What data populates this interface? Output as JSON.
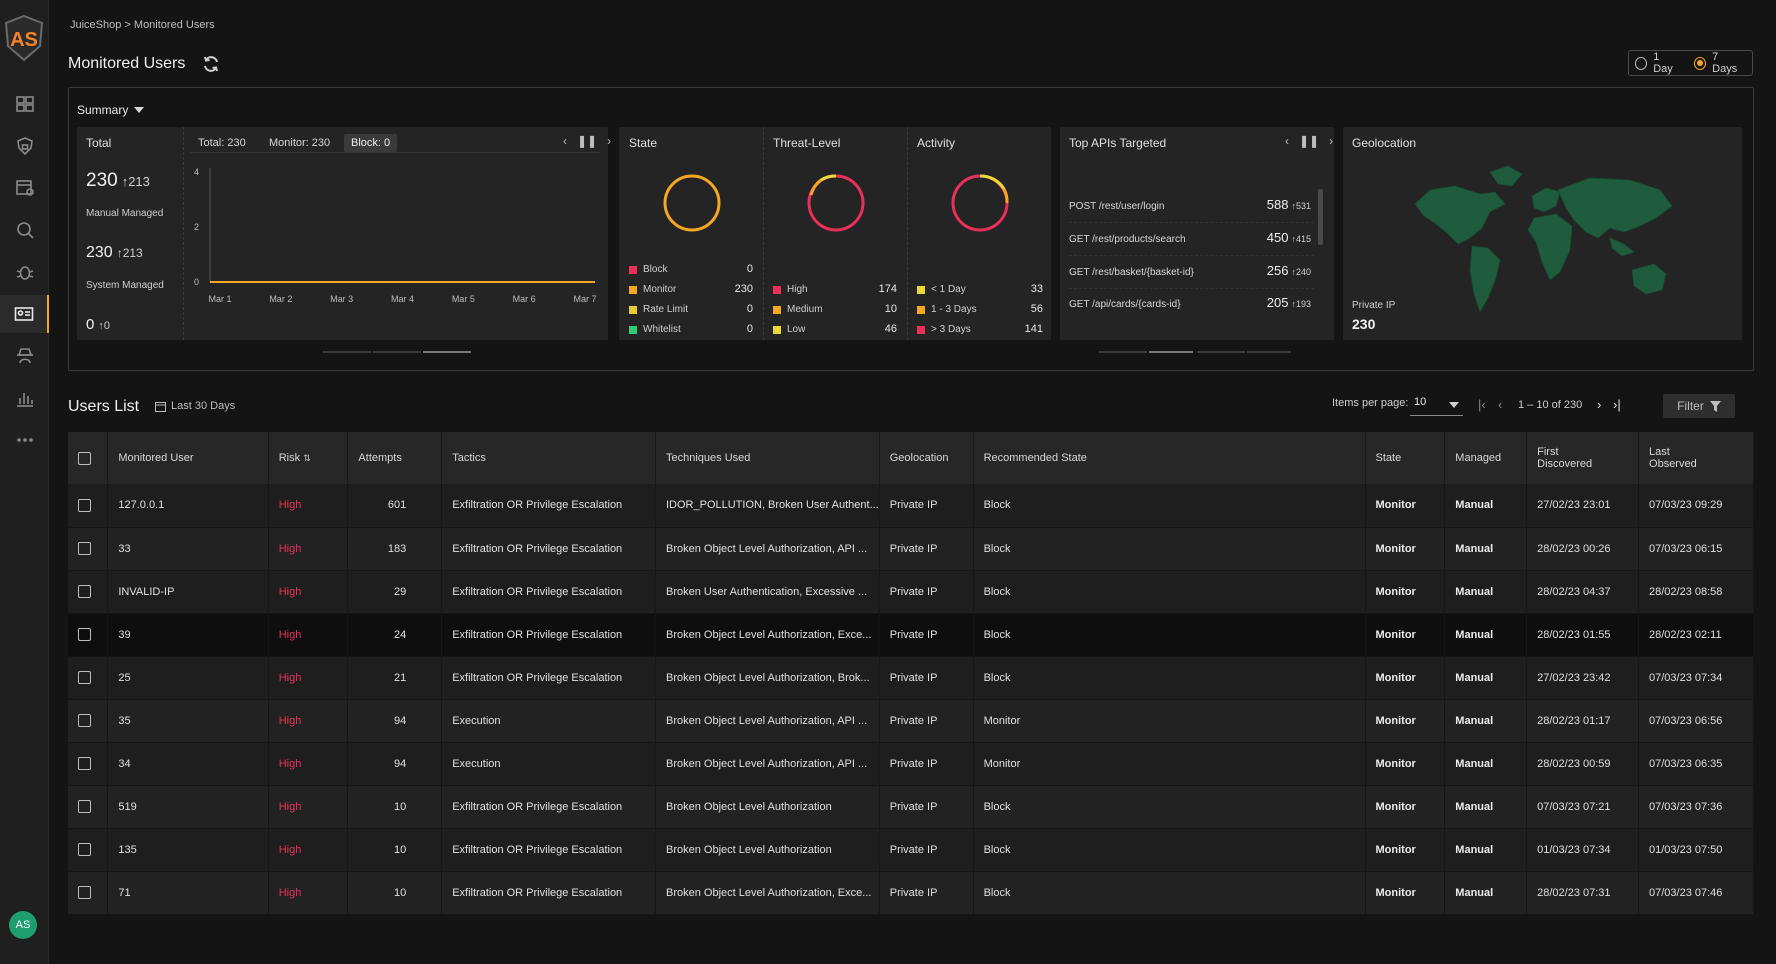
{
  "breadcrumb": "JuiceShop > Monitored Users",
  "page_title": "Monitored Users",
  "range": {
    "option1": "1 Day",
    "option2": "7 Days",
    "selected": "7 Days"
  },
  "summary": {
    "toggle": "Summary",
    "total": {
      "title": "Total",
      "manual_value": "230",
      "manual_delta": "213",
      "manual_label": "Manual Managed",
      "system_value": "230",
      "system_delta": "213",
      "system_label": "System Managed",
      "other_value": "0",
      "other_delta": "0"
    },
    "chips": {
      "total": "Total: 230",
      "monitor": "Monitor: 230",
      "block": "Block: 0"
    },
    "state": {
      "title": "State",
      "items": [
        {
          "label": "Block",
          "value": "0",
          "color": "#e8305a"
        },
        {
          "label": "Monitor",
          "value": "230",
          "color": "#f5a623"
        },
        {
          "label": "Rate Limit",
          "value": "0",
          "color": "#e8c93a"
        },
        {
          "label": "Whitelist",
          "value": "0",
          "color": "#2ecc71"
        }
      ]
    },
    "threat": {
      "title": "Threat-Level",
      "items": [
        {
          "label": "High",
          "value": "174",
          "color": "#e8305a"
        },
        {
          "label": "Medium",
          "value": "10",
          "color": "#f5a623"
        },
        {
          "label": "Low",
          "value": "46",
          "color": "#e8d83a"
        }
      ]
    },
    "activity": {
      "title": "Activity",
      "items": [
        {
          "label": "< 1 Day",
          "value": "33",
          "color": "#e8d83a"
        },
        {
          "label": "1 - 3 Days",
          "value": "56",
          "color": "#f5a623"
        },
        {
          "label": "> 3 Days",
          "value": "141",
          "color": "#e8305a"
        }
      ]
    },
    "top_apis": {
      "title": "Top APIs Targeted",
      "items": [
        {
          "api": "POST /rest/user/login",
          "value": "588",
          "delta": "531"
        },
        {
          "api": "GET /rest/products/search",
          "value": "450",
          "delta": "415"
        },
        {
          "api": "GET /rest/basket/{basket-id}",
          "value": "256",
          "delta": "240"
        },
        {
          "api": "GET /api/cards/{cards-id}",
          "value": "205",
          "delta": "193"
        }
      ]
    },
    "geo": {
      "title": "Geolocation",
      "label": "Private IP",
      "value": "230"
    }
  },
  "chart_data": {
    "type": "line",
    "categories": [
      "Mar 1",
      "Mar 2",
      "Mar 3",
      "Mar 4",
      "Mar 5",
      "Mar 6",
      "Mar 7"
    ],
    "series": [
      {
        "values": [
          0,
          0,
          0,
          0,
          0,
          0,
          0
        ]
      }
    ],
    "yticks": [
      "4",
      "2",
      "0"
    ],
    "ylim": [
      0,
      4
    ]
  },
  "users_list": {
    "title": "Users List",
    "period": "Last 30 Days",
    "items_per_page_label": "Items per page:",
    "items_per_page": "10",
    "range": "1 – 10 of 230",
    "filter": "Filter",
    "columns": [
      "Monitored User",
      "Risk",
      "Attempts",
      "Tactics",
      "Techniques Used",
      "Geolocation",
      "Recommended State",
      "State",
      "Managed",
      "First Discovered",
      "Last Observed"
    ],
    "rows": [
      [
        "127.0.0.1",
        "High",
        "601",
        "Exfiltration OR Privilege Escalation",
        "IDOR_POLLUTION, Broken User Authent...",
        "Private IP",
        "Block",
        "Monitor",
        "Manual",
        "27/02/23 23:01",
        "07/03/23 09:29"
      ],
      [
        "33",
        "High",
        "183",
        "Exfiltration OR Privilege Escalation",
        "Broken Object Level Authorization, API ...",
        "Private IP",
        "Block",
        "Monitor",
        "Manual",
        "28/02/23 00:26",
        "07/03/23 06:15"
      ],
      [
        "INVALID-IP",
        "High",
        "29",
        "Exfiltration OR Privilege Escalation",
        "Broken User Authentication, Excessive ...",
        "Private IP",
        "Block",
        "Monitor",
        "Manual",
        "28/02/23 04:37",
        "28/02/23 08:58"
      ],
      [
        "39",
        "High",
        "24",
        "Exfiltration OR Privilege Escalation",
        "Broken Object Level Authorization, Exce...",
        "Private IP",
        "Block",
        "Monitor",
        "Manual",
        "28/02/23 01:55",
        "28/02/23 02:11"
      ],
      [
        "25",
        "High",
        "21",
        "Exfiltration OR Privilege Escalation",
        "Broken Object Level Authorization, Brok...",
        "Private IP",
        "Block",
        "Monitor",
        "Manual",
        "27/02/23 23:42",
        "07/03/23 07:34"
      ],
      [
        "35",
        "High",
        "94",
        "Execution",
        "Broken Object Level Authorization, API ...",
        "Private IP",
        "Monitor",
        "Monitor",
        "Manual",
        "28/02/23 01:17",
        "07/03/23 06:56"
      ],
      [
        "34",
        "High",
        "94",
        "Execution",
        "Broken Object Level Authorization, API ...",
        "Private IP",
        "Monitor",
        "Monitor",
        "Manual",
        "28/02/23 00:59",
        "07/03/23 06:35"
      ],
      [
        "519",
        "High",
        "10",
        "Exfiltration OR Privilege Escalation",
        "Broken Object Level Authorization",
        "Private IP",
        "Block",
        "Monitor",
        "Manual",
        "07/03/23 07:21",
        "07/03/23 07:36"
      ],
      [
        "135",
        "High",
        "10",
        "Exfiltration OR Privilege Escalation",
        "Broken Object Level Authorization",
        "Private IP",
        "Block",
        "Monitor",
        "Manual",
        "01/03/23 07:34",
        "01/03/23 07:50"
      ],
      [
        "71",
        "High",
        "10",
        "Exfiltration OR Privilege Escalation",
        "Broken Object Level Authorization, Exce...",
        "Private IP",
        "Block",
        "Monitor",
        "Manual",
        "28/02/23 07:31",
        "07/03/23 07:46"
      ]
    ]
  },
  "user_initials": "AS",
  "icons": [
    "dashboard-icon",
    "shield-lock-icon",
    "inventory-icon",
    "search-icon",
    "bug-icon",
    "user-card-icon",
    "spy-icon",
    "bar-chart-icon",
    "more-icon"
  ]
}
